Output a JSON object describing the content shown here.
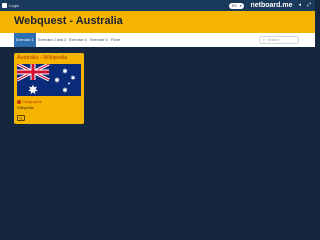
{
  "topbar": {
    "login_label": "Login",
    "lang_label": "EN",
    "brand": "netboard.me"
  },
  "header": {
    "title": "Webquest - Australia"
  },
  "nav": {
    "tabs": [
      {
        "label": "Exercise 1",
        "active": true
      },
      {
        "label": "Exercise 2 and 3",
        "active": false
      },
      {
        "label": "Exercise 4",
        "active": false
      },
      {
        "label": "Exercise 5",
        "active": false
      },
      {
        "label": "Fiche",
        "active": false
      }
    ],
    "search_placeholder": "Search"
  },
  "card": {
    "title": "Australia - Wikipedia",
    "tag": "Geographie",
    "link_text": "Wikipedia"
  },
  "colors": {
    "background": "#14273f",
    "header": "#f5b400",
    "active_tab": "#2f6fb1",
    "flag_blue": "#0a2a7a",
    "flag_red": "#d21034"
  }
}
